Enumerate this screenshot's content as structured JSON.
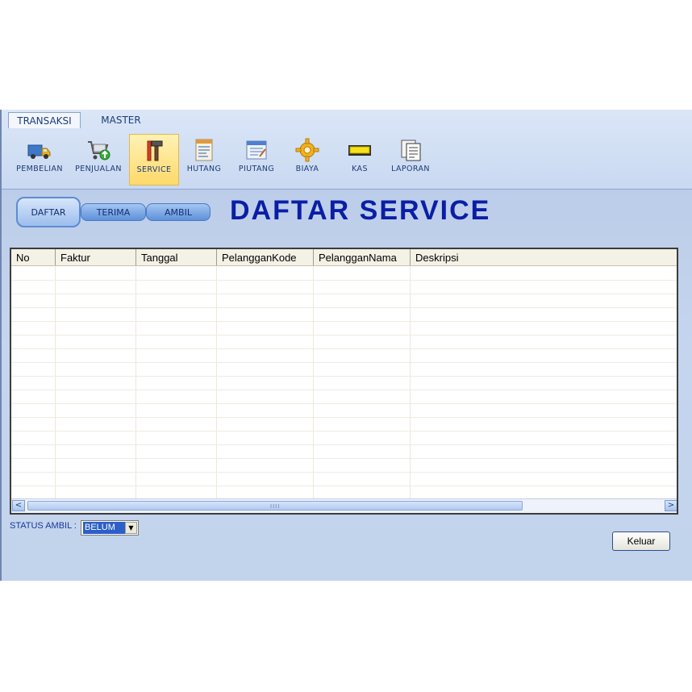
{
  "ribbon": {
    "tabs": [
      {
        "label": "TRANSAKSI",
        "active": true
      },
      {
        "label": "MASTER",
        "active": false
      }
    ],
    "buttons": [
      {
        "label": "PEMBELIAN",
        "icon": "truck-icon"
      },
      {
        "label": "PENJUALAN",
        "icon": "shopping-cart-icon"
      },
      {
        "label": "SERVICE",
        "icon": "tools-icon",
        "active": true
      },
      {
        "label": "HUTANG",
        "icon": "ledger-icon"
      },
      {
        "label": "PIUTANG",
        "icon": "invoice-icon"
      },
      {
        "label": "BIAYA",
        "icon": "gear-icon"
      },
      {
        "label": "KAS",
        "icon": "cash-icon"
      },
      {
        "label": "LAPORAN",
        "icon": "report-icon"
      }
    ]
  },
  "nav": {
    "daftar": "DAFTAR",
    "terima": "TERIMA",
    "ambil": "AMBIL"
  },
  "page": {
    "title": "DAFTAR SERVICE"
  },
  "grid": {
    "columns": [
      "No",
      "Faktur",
      "Tanggal",
      "PelangganKode",
      "PelangganNama",
      "Deskripsi"
    ],
    "rows": []
  },
  "scrollbar": {
    "left_arrow": "<",
    "right_arrow": ">",
    "grip": "IIII"
  },
  "status": {
    "label": "STATUS AMBIL :",
    "selected": "BELUM"
  },
  "actions": {
    "keluar": "Keluar"
  },
  "colors": {
    "title": "#0a1ea5",
    "app_background": "#c6d6ee",
    "active_ribbon": "#ffd96a"
  }
}
